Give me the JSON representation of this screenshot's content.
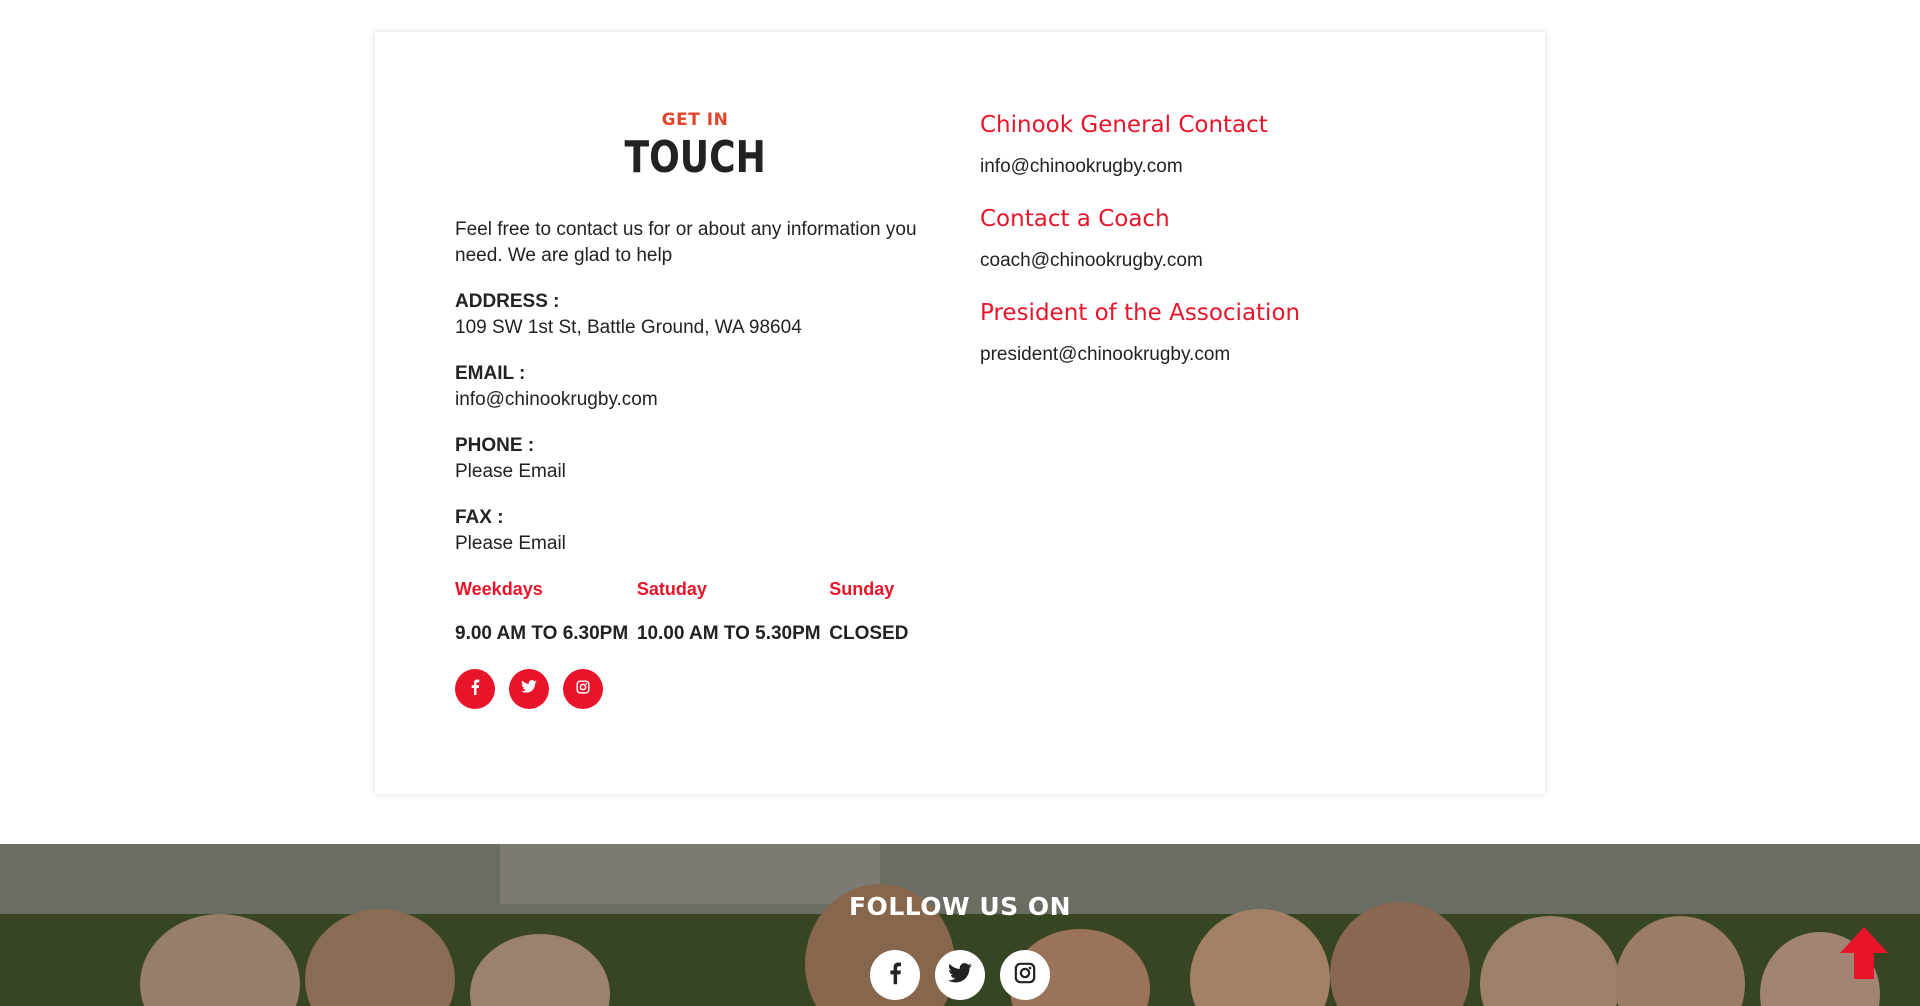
{
  "contact_section": {
    "heading_small": "GET IN",
    "heading_large": "TOUCH",
    "intro": "Feel free to contact us for or about any information you need. We are glad to help",
    "address": {
      "label": "ADDRESS :",
      "value": "109 SW 1st St, Battle Ground, WA 98604"
    },
    "email": {
      "label": "EMAIL :",
      "value": "info@chinookrugby.com"
    },
    "phone": {
      "label": "PHONE :",
      "value": "Please Email"
    },
    "fax": {
      "label": "FAX :",
      "value": "Please Email"
    },
    "hours": [
      {
        "day": "Weekdays",
        "time": "9.00 AM TO 6.30PM"
      },
      {
        "day": "Satuday",
        "time": "10.00 AM TO 5.30PM"
      },
      {
        "day": "Sunday",
        "time": "CLOSED"
      }
    ],
    "social_icons": [
      "facebook-icon",
      "twitter-icon",
      "instagram-icon"
    ]
  },
  "contacts": [
    {
      "title": "Chinook General Contact",
      "email": "info@chinookrugby.com"
    },
    {
      "title": "Contact a Coach",
      "email": "coach@chinookrugby.com"
    },
    {
      "title": "President of the Association",
      "email": "president@chinookrugby.com"
    }
  ],
  "footer_banner": {
    "follow_label": "FOLLOW US ON",
    "social_icons": [
      "facebook-icon",
      "twitter-icon",
      "instagram-icon"
    ]
  },
  "colors": {
    "accent_red": "#e8152a",
    "heading_orange": "#e2452a"
  }
}
